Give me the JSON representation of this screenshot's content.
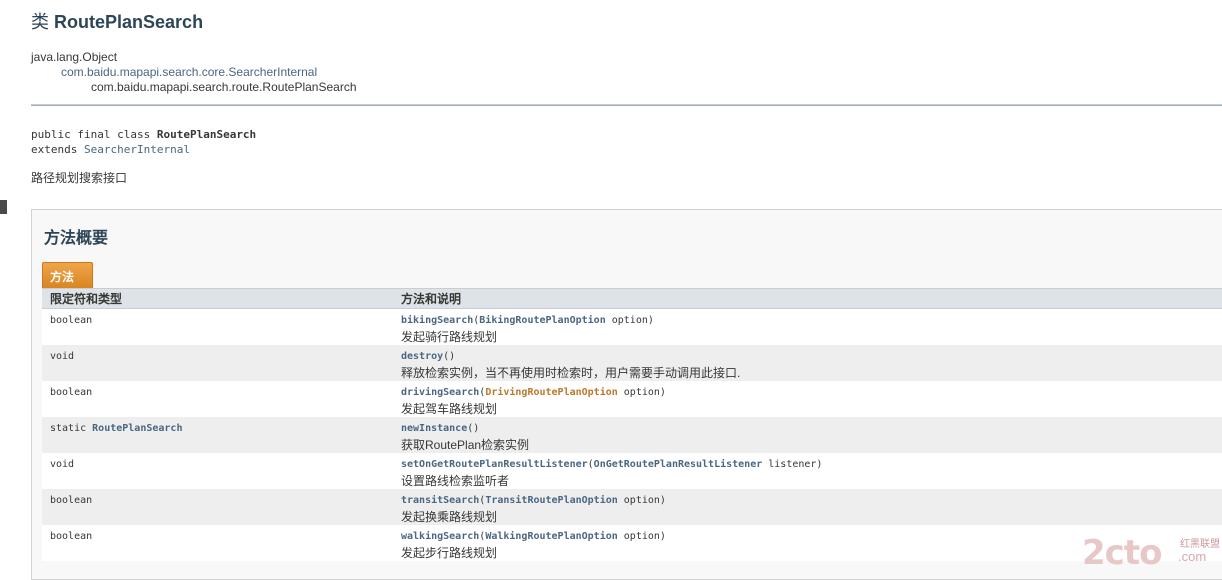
{
  "page": {
    "title_prefix": "类 ",
    "title_name": "RoutePlanSearch"
  },
  "inheritance": [
    "java.lang.Object",
    "com.baidu.mapapi.search.core.SearcherInternal",
    "com.baidu.mapapi.search.route.RoutePlanSearch"
  ],
  "signature": {
    "line1_prefix": "public final class ",
    "line1_class": "RoutePlanSearch",
    "line2_prefix": "extends ",
    "line2_super": "SearcherInternal"
  },
  "description": "路径规划搜索接口",
  "summary": {
    "heading": "方法概要",
    "tab_label": "方法",
    "col1_header": "限定符和类型",
    "col2_header": "方法和说明",
    "rows": [
      {
        "modifier": "boolean",
        "modifier_link": "",
        "method": "bikingSearch",
        "open": "(",
        "param_type": "BikingRoutePlanOption",
        "param_name": " option)",
        "desc": "发起骑行路线规划"
      },
      {
        "modifier": "void",
        "modifier_link": "",
        "method": "destroy",
        "open": "()",
        "param_type": "",
        "param_name": "",
        "desc": "释放检索实例，当不再使用时检索时，用户需要手动调用此接口."
      },
      {
        "modifier": "boolean",
        "modifier_link": "",
        "method": "drivingSearch",
        "open": "(",
        "param_type": "DrivingRoutePlanOption",
        "param_name": " option)",
        "desc": "发起驾车路线规划"
      },
      {
        "modifier": "static ",
        "modifier_link": "RoutePlanSearch",
        "method": "newInstance",
        "open": "()",
        "param_type": "",
        "param_name": "",
        "desc": "获取RoutePlan检索实例"
      },
      {
        "modifier": "void",
        "modifier_link": "",
        "method": "setOnGetRoutePlanResultListener",
        "open": "(",
        "param_type": "OnGetRoutePlanResultListener",
        "param_name": " listener)",
        "desc": "设置路线检索监听者"
      },
      {
        "modifier": "boolean",
        "modifier_link": "",
        "method": "transitSearch",
        "open": "(",
        "param_type": "TransitRoutePlanOption",
        "param_name": " option)",
        "desc": "发起换乘路线规划"
      },
      {
        "modifier": "boolean",
        "modifier_link": "",
        "method": "walkingSearch",
        "open": "(",
        "param_type": "WalkingRoutePlanOption",
        "param_name": " option)",
        "desc": "发起步行路线规划"
      }
    ]
  },
  "watermark": {
    "big": "2cto",
    "small_top": "红黑联盟",
    "small_bottom": ".com"
  }
}
